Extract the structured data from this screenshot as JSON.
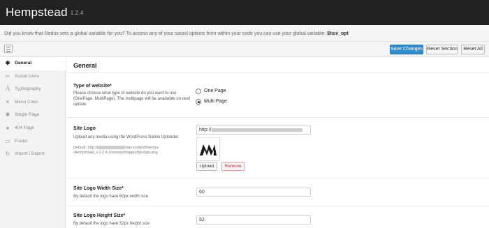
{
  "header": {
    "title": "Hempstead",
    "version": "1.2.4"
  },
  "notice": {
    "text": "Did you know that Redux sets a global variable for you? To access any of your saved options from within your code you can use your global variable:",
    "variable": "$hsv_opt"
  },
  "toolbar": {
    "save_label": "Save Changes",
    "reset_section_label": "Reset Section",
    "reset_all_label": "Reset All"
  },
  "sidebar": {
    "items": [
      {
        "label": "General",
        "icon": "gear-icon",
        "active": true
      },
      {
        "label": "Social Icons",
        "icon": "wrench-icon",
        "active": false
      },
      {
        "label": "Typhography",
        "icon": "font-icon",
        "active": false
      },
      {
        "label": "Menu Color",
        "icon": "tools-icon",
        "active": false
      },
      {
        "label": "Single Page",
        "icon": "gear-icon",
        "active": false
      },
      {
        "label": "404 Page",
        "icon": "info-icon",
        "active": false
      },
      {
        "label": "Footer",
        "icon": "footer-icon",
        "active": false
      },
      {
        "label": "Import / Export",
        "icon": "refresh-icon",
        "active": false
      }
    ]
  },
  "main": {
    "section_title": "General",
    "website_type": {
      "title": "Type of website*",
      "desc": "Please choose what type of website do you want to use (OnePage, MultiPage). The multipage will be availaible on next update",
      "options": [
        {
          "label": "One Page",
          "checked": false
        },
        {
          "label": "Multi Page",
          "checked": true
        }
      ]
    },
    "site_logo": {
      "title": "Site Logo",
      "desc": "Upload any media using the WordPress Native Uploader.",
      "default_prefix": "Default: http://",
      "default_suffix": "/wp-content/themes",
      "default_path": "/Hempstead_v.1.2.4.2/assets/images/bg-logo.png",
      "url_prefix": "http://",
      "upload_label": "Upload",
      "remove_label": "Remove"
    },
    "logo_width": {
      "title": "Site Logo Width Size*",
      "desc": "By default the logo have 60px width size",
      "value": "60"
    },
    "logo_height": {
      "title": "Site Logo Height Size*",
      "desc": "By default the logo have 52px height size",
      "value": "52"
    }
  }
}
